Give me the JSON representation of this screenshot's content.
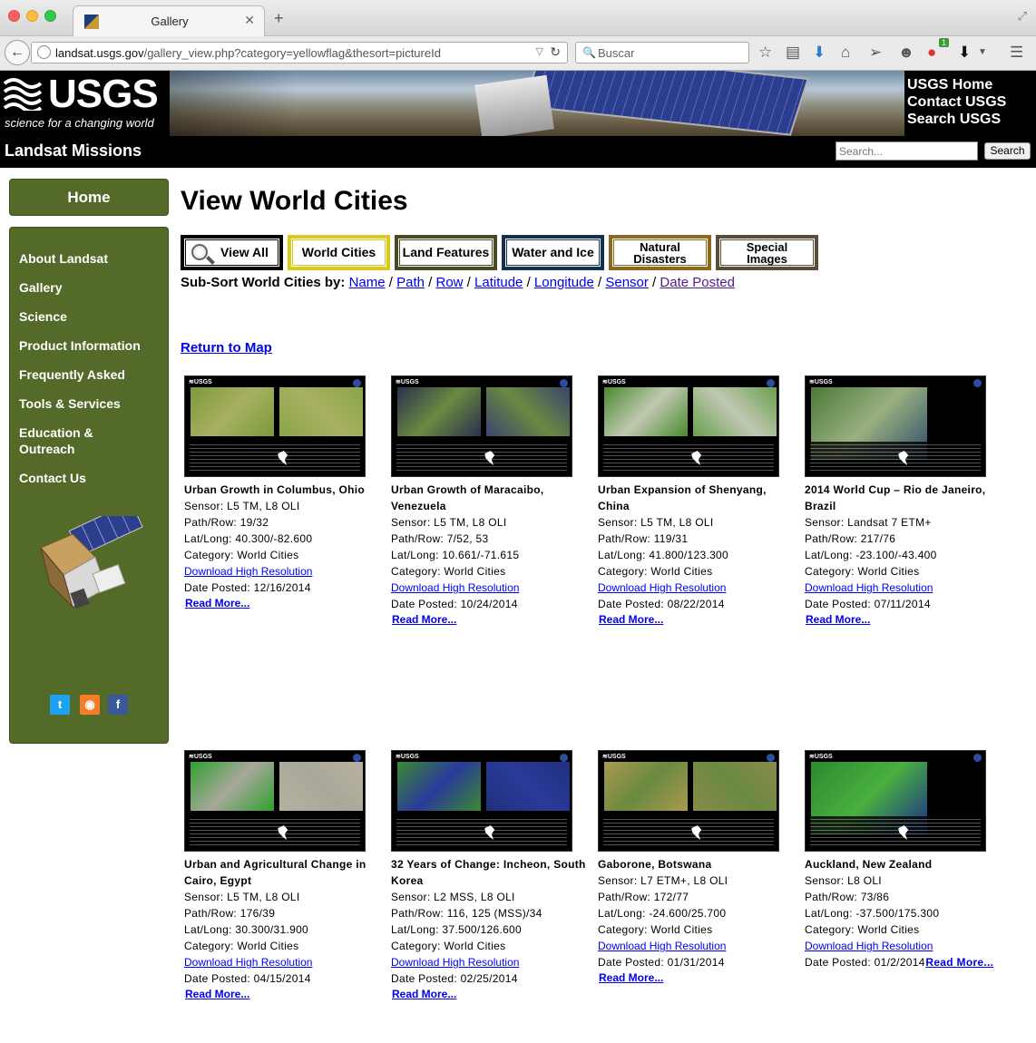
{
  "browser": {
    "tab_title": "Gallery",
    "url_host": "landsat.usgs.gov",
    "url_path": "/gallery_view.php?category=yellowflag&thesort=pictureId",
    "search_placeholder": "Buscar",
    "badge_count": "1"
  },
  "header": {
    "logo_text": "USGS",
    "logo_tagline": "science for a changing world",
    "links": [
      "USGS Home",
      "Contact USGS",
      "Search USGS"
    ],
    "mission_title": "Landsat Missions",
    "search_placeholder": "Search...",
    "search_button": "Search"
  },
  "sidebar": {
    "home": "Home",
    "items": [
      "About Landsat",
      "Gallery",
      "Science",
      "Product Information",
      "Frequently Asked",
      "Tools & Services",
      "Education & Outreach",
      "Contact Us"
    ],
    "social": [
      "twitter-icon",
      "rss-icon",
      "facebook-icon"
    ]
  },
  "main": {
    "title": "View World Cities",
    "categories": [
      {
        "label": "View All",
        "color": "#000000"
      },
      {
        "label": "World Cities",
        "color": "#d8c91c"
      },
      {
        "label": "Land Features",
        "color": "#4a4a22"
      },
      {
        "label": "Water and Ice",
        "color": "#13304f"
      },
      {
        "label": "Natural Disasters",
        "color": "#8a6a1f"
      },
      {
        "label": "Special Images",
        "color": "#5a4e3a"
      }
    ],
    "subsort_label": "Sub-Sort World Cities by:",
    "subsort_links": [
      "Name",
      "Path",
      "Row",
      "Latitude",
      "Longitude",
      "Sensor",
      "Date Posted"
    ],
    "return_link": "Return to Map",
    "labels": {
      "sensor": "Sensor:",
      "pathrow": "Path/Row:",
      "latlong": "Lat/Long:",
      "category": "Category:",
      "posted": "Date Posted:",
      "download": "Download High Resolution",
      "read_more": "Read More..."
    },
    "cards": [
      {
        "title": "Urban Growth in Columbus, Ohio",
        "sensor": "L5 TM, L8 OLI",
        "pathrow": "19/32",
        "latlong": "40.300/-82.600",
        "category": "World Cities",
        "posted": "12/16/2014"
      },
      {
        "title": "Urban Growth of Maracaibo, Venezuela",
        "sensor": "L5 TM, L8 OLI",
        "pathrow": "7/52, 53",
        "latlong": "10.661/-71.615",
        "category": "World Cities",
        "posted": "10/24/2014"
      },
      {
        "title": "Urban Expansion of Shenyang, China",
        "sensor": "L5 TM, L8 OLI",
        "pathrow": "119/31",
        "latlong": "41.800/123.300",
        "category": "World Cities",
        "posted": "08/22/2014"
      },
      {
        "title": "2014 World Cup – Rio de Janeiro, Brazil",
        "sensor": "Landsat 7 ETM+",
        "pathrow": "217/76",
        "latlong": "-23.100/-43.400",
        "category": "World Cities",
        "posted": "07/11/2014"
      },
      {
        "title": "Urban and Agricultural Change in Cairo, Egypt",
        "sensor": "L5 TM, L8 OLI",
        "pathrow": "176/39",
        "latlong": "30.300/31.900",
        "category": "World Cities",
        "posted": "04/15/2014"
      },
      {
        "title": "32 Years of Change: Incheon, South Korea",
        "sensor": "L2 MSS, L8 OLI",
        "pathrow": "116, 125 (MSS)/34",
        "latlong": "37.500/126.600",
        "category": "World Cities",
        "posted": "02/25/2014"
      },
      {
        "title": "Gaborone, Botswana",
        "sensor": "L7 ETM+, L8 OLI",
        "pathrow": "172/77",
        "latlong": "-24.600/25.700",
        "category": "World Cities",
        "posted": "01/31/2014"
      },
      {
        "title": "Auckland, New Zealand",
        "sensor": "L8 OLI",
        "pathrow": "73/86",
        "latlong": "-37.500/175.300",
        "category": "World Cities",
        "posted": "01/2/2014"
      }
    ]
  }
}
